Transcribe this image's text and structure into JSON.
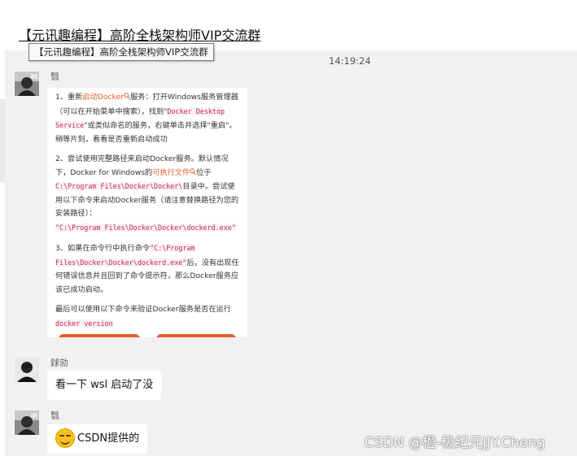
{
  "window": {
    "group_title": "【元讯趣编程】高阶全栈架构师VIP交流群",
    "tooltip": "【元讯趣编程】高阶全栈架构师VIP交流群"
  },
  "timestamp": "14:19:24",
  "messages": [
    {
      "sender": "翳",
      "type": "image",
      "steps": {
        "s1_a": "1、重新",
        "s1_link": "启动Docker",
        "s1_b": "服务：打开Windows服务管理器（可以在开始菜单中搜索），找到\"",
        "s1_code": "Docker Desktop Service",
        "s1_c": "\"或类似命名的服务，右键单击并选择\"重启\"。稍等片刻，看看是否重新启动成功",
        "s2_a": "2、尝试使用完整路径来启动Docker服务。默认情况下，Docker for Windows的",
        "s2_link": "可执行文件",
        "s2_b": "位于",
        "s2_code1": "C:\\Program Files\\Docker\\Docker\\",
        "s2_c": "目录中。尝试使用以下命令来启动Docker服务（请注意替换路径为您的安装路径）：",
        "s2_code2": "\"C:\\Program Files\\Docker\\Docker\\dockerd.exe\"",
        "s3_a": "3、如果在命令行中执行命令",
        "s3_code": "\"C:\\Program Files\\Docker\\Docker\\dockerd.exe\"",
        "s3_b": "后，没有出现任何错误信息并且回到了命令提示符，那么Docker服务应该已成功启动。",
        "s4_a": "最后可以使用以下命令来验证Docker服务是否在运行",
        "s4_code": "docker version"
      }
    },
    {
      "sender": "銶勍",
      "type": "text",
      "text": "看一下 wsl 启动了没"
    },
    {
      "sender": "翳",
      "type": "text",
      "text": "CSDN提供的"
    }
  ],
  "watermark": "CSDN @橙-极纪元JJY.Cheng",
  "colors": {
    "link_orange": "#e85d2a",
    "code_red": "#c7254e",
    "chat_bg": "#f1f1f1"
  },
  "icons": [
    "search-icon",
    "search-icon",
    "grin-emoji-icon"
  ]
}
